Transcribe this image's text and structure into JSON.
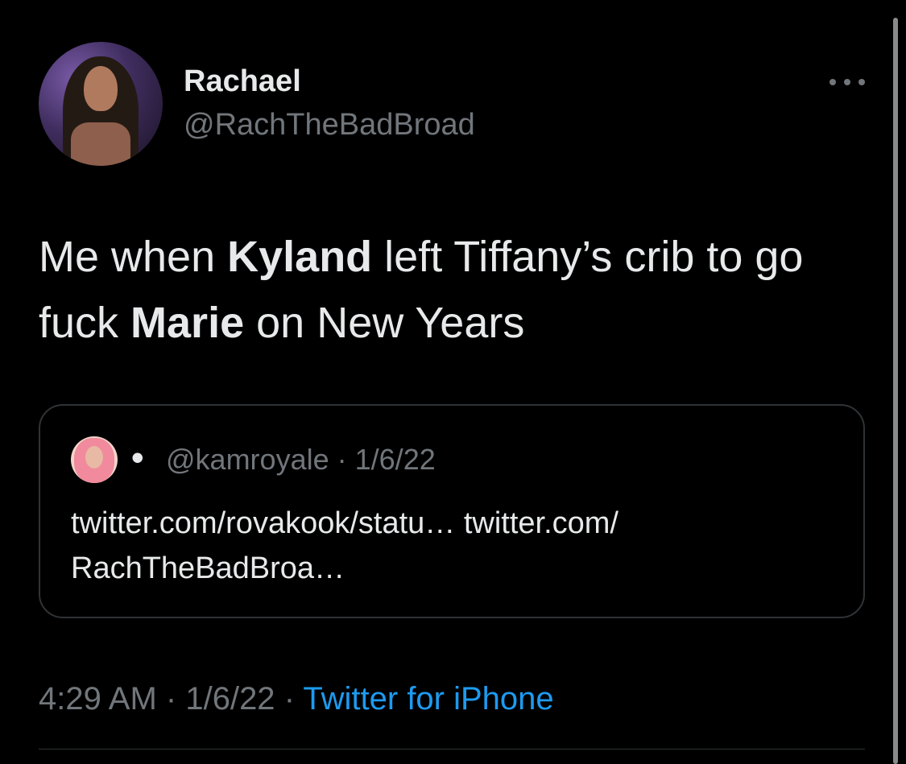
{
  "tweet": {
    "display_name": "Rachael",
    "handle": "@RachTheBadBroad",
    "text_parts": {
      "p1": "Me when ",
      "b1": "Kyland",
      "p2": " left Tiffany’s crib to go fuck ",
      "b2": "Marie",
      "p3": " on New Years"
    },
    "time": "4:29 AM",
    "date": "1/6/22",
    "source": "Twitter for iPhone",
    "separator": "·"
  },
  "quote": {
    "name": "ꔷ",
    "handle": "@kamroyale",
    "separator": "·",
    "date": "1/6/22",
    "line1": "twitter.com/rovakook/statu… twitter.com/",
    "line2": "RachTheBadBroa…"
  },
  "icons": {
    "more": "more-horizontal-icon"
  },
  "colors": {
    "background": "#000000",
    "text": "#e7e9ea",
    "secondary": "#71767b",
    "link": "#1d9bf0",
    "border": "#2f3336"
  }
}
